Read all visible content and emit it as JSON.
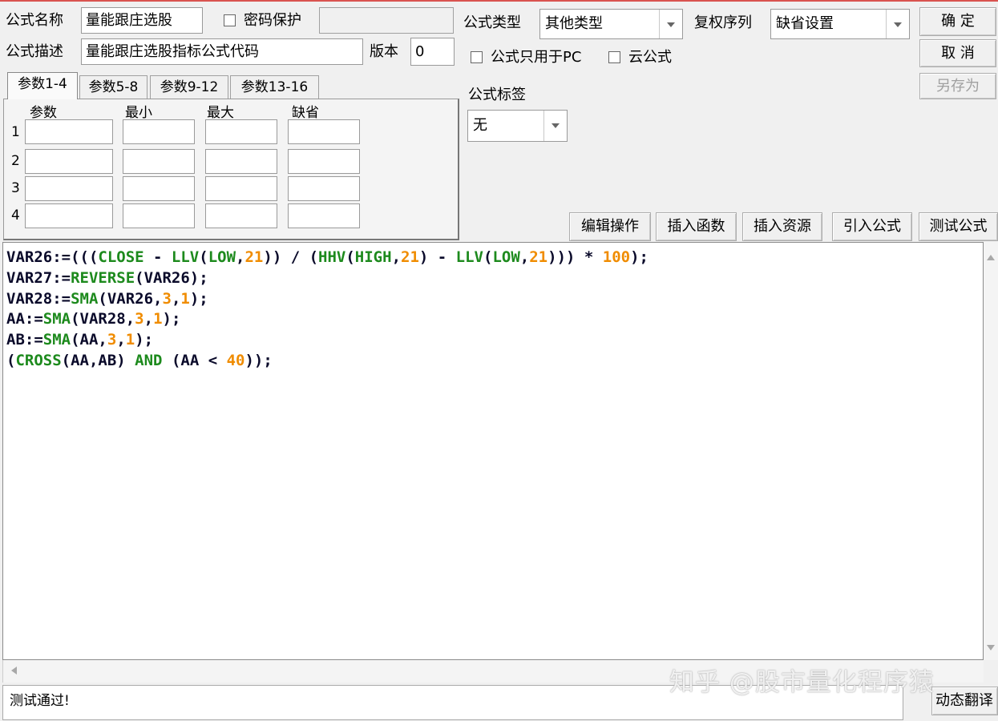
{
  "header": {
    "name_label": "公式名称",
    "name_value": "量能跟庄选股",
    "password_label": "密码保护",
    "desc_label": "公式描述",
    "desc_value": "量能跟庄选股指标公式代码",
    "version_label": "版本",
    "version_value": "0",
    "type_label": "公式类型",
    "type_value": "其他类型",
    "rights_label": "复权序列",
    "rights_value": "缺省设置",
    "pc_only_label": "公式只用于PC",
    "cloud_label": "云公式",
    "tag_label": "公式标签",
    "tag_value": "无"
  },
  "buttons": {
    "ok": "确 定",
    "cancel": "取 消",
    "save_as": "另存为",
    "edit_ops": "编辑操作",
    "insert_func": "插入函数",
    "insert_res": "插入资源",
    "import_formula": "引入公式",
    "test_formula": "测试公式",
    "dynamic_translate": "动态翻译"
  },
  "params": {
    "tabs": [
      "参数1-4",
      "参数5-8",
      "参数9-12",
      "参数13-16"
    ],
    "columns": [
      "参数",
      "最小",
      "最大",
      "缺省"
    ],
    "rows": [
      "1",
      "2",
      "3",
      "4"
    ]
  },
  "code_lines": [
    [
      [
        "t",
        "VAR26:=((("
      ],
      [
        "k",
        "CLOSE"
      ],
      [
        "t",
        " - "
      ],
      [
        "k",
        "LLV"
      ],
      [
        "t",
        "("
      ],
      [
        "k",
        "LOW"
      ],
      [
        "t",
        ","
      ],
      [
        "n",
        "21"
      ],
      [
        "t",
        ")) / ("
      ],
      [
        "k",
        "HHV"
      ],
      [
        "t",
        "("
      ],
      [
        "k",
        "HIGH"
      ],
      [
        "t",
        ","
      ],
      [
        "n",
        "21"
      ],
      [
        "t",
        ") - "
      ],
      [
        "k",
        "LLV"
      ],
      [
        "t",
        "("
      ],
      [
        "k",
        "LOW"
      ],
      [
        "t",
        ","
      ],
      [
        "n",
        "21"
      ],
      [
        "t",
        "))) * "
      ],
      [
        "n",
        "100"
      ],
      [
        "t",
        ");"
      ]
    ],
    [
      [
        "t",
        "VAR27:="
      ],
      [
        "k",
        "REVERSE"
      ],
      [
        "t",
        "(VAR26);"
      ]
    ],
    [
      [
        "t",
        "VAR28:="
      ],
      [
        "k",
        "SMA"
      ],
      [
        "t",
        "(VAR26,"
      ],
      [
        "n",
        "3"
      ],
      [
        "t",
        ","
      ],
      [
        "n",
        "1"
      ],
      [
        "t",
        ");"
      ]
    ],
    [
      [
        "t",
        "AA:="
      ],
      [
        "k",
        "SMA"
      ],
      [
        "t",
        "(VAR28,"
      ],
      [
        "n",
        "3"
      ],
      [
        "t",
        ","
      ],
      [
        "n",
        "1"
      ],
      [
        "t",
        ");"
      ]
    ],
    [
      [
        "t",
        "AB:="
      ],
      [
        "k",
        "SMA"
      ],
      [
        "t",
        "(AA,"
      ],
      [
        "n",
        "3"
      ],
      [
        "t",
        ","
      ],
      [
        "n",
        "1"
      ],
      [
        "t",
        ");"
      ]
    ],
    [
      [
        "t",
        "("
      ],
      [
        "k",
        "CROSS"
      ],
      [
        "t",
        "(AA,AB) "
      ],
      [
        "k",
        "AND"
      ],
      [
        "t",
        " (AA < "
      ],
      [
        "n",
        "40"
      ],
      [
        "t",
        "));"
      ]
    ]
  ],
  "status_text": "测试通过!",
  "watermark": "知乎 @股市量化程序猿",
  "colors": {
    "keyword": "#1d8a1d",
    "number": "#f08c00",
    "text": "#0a0a2a"
  }
}
